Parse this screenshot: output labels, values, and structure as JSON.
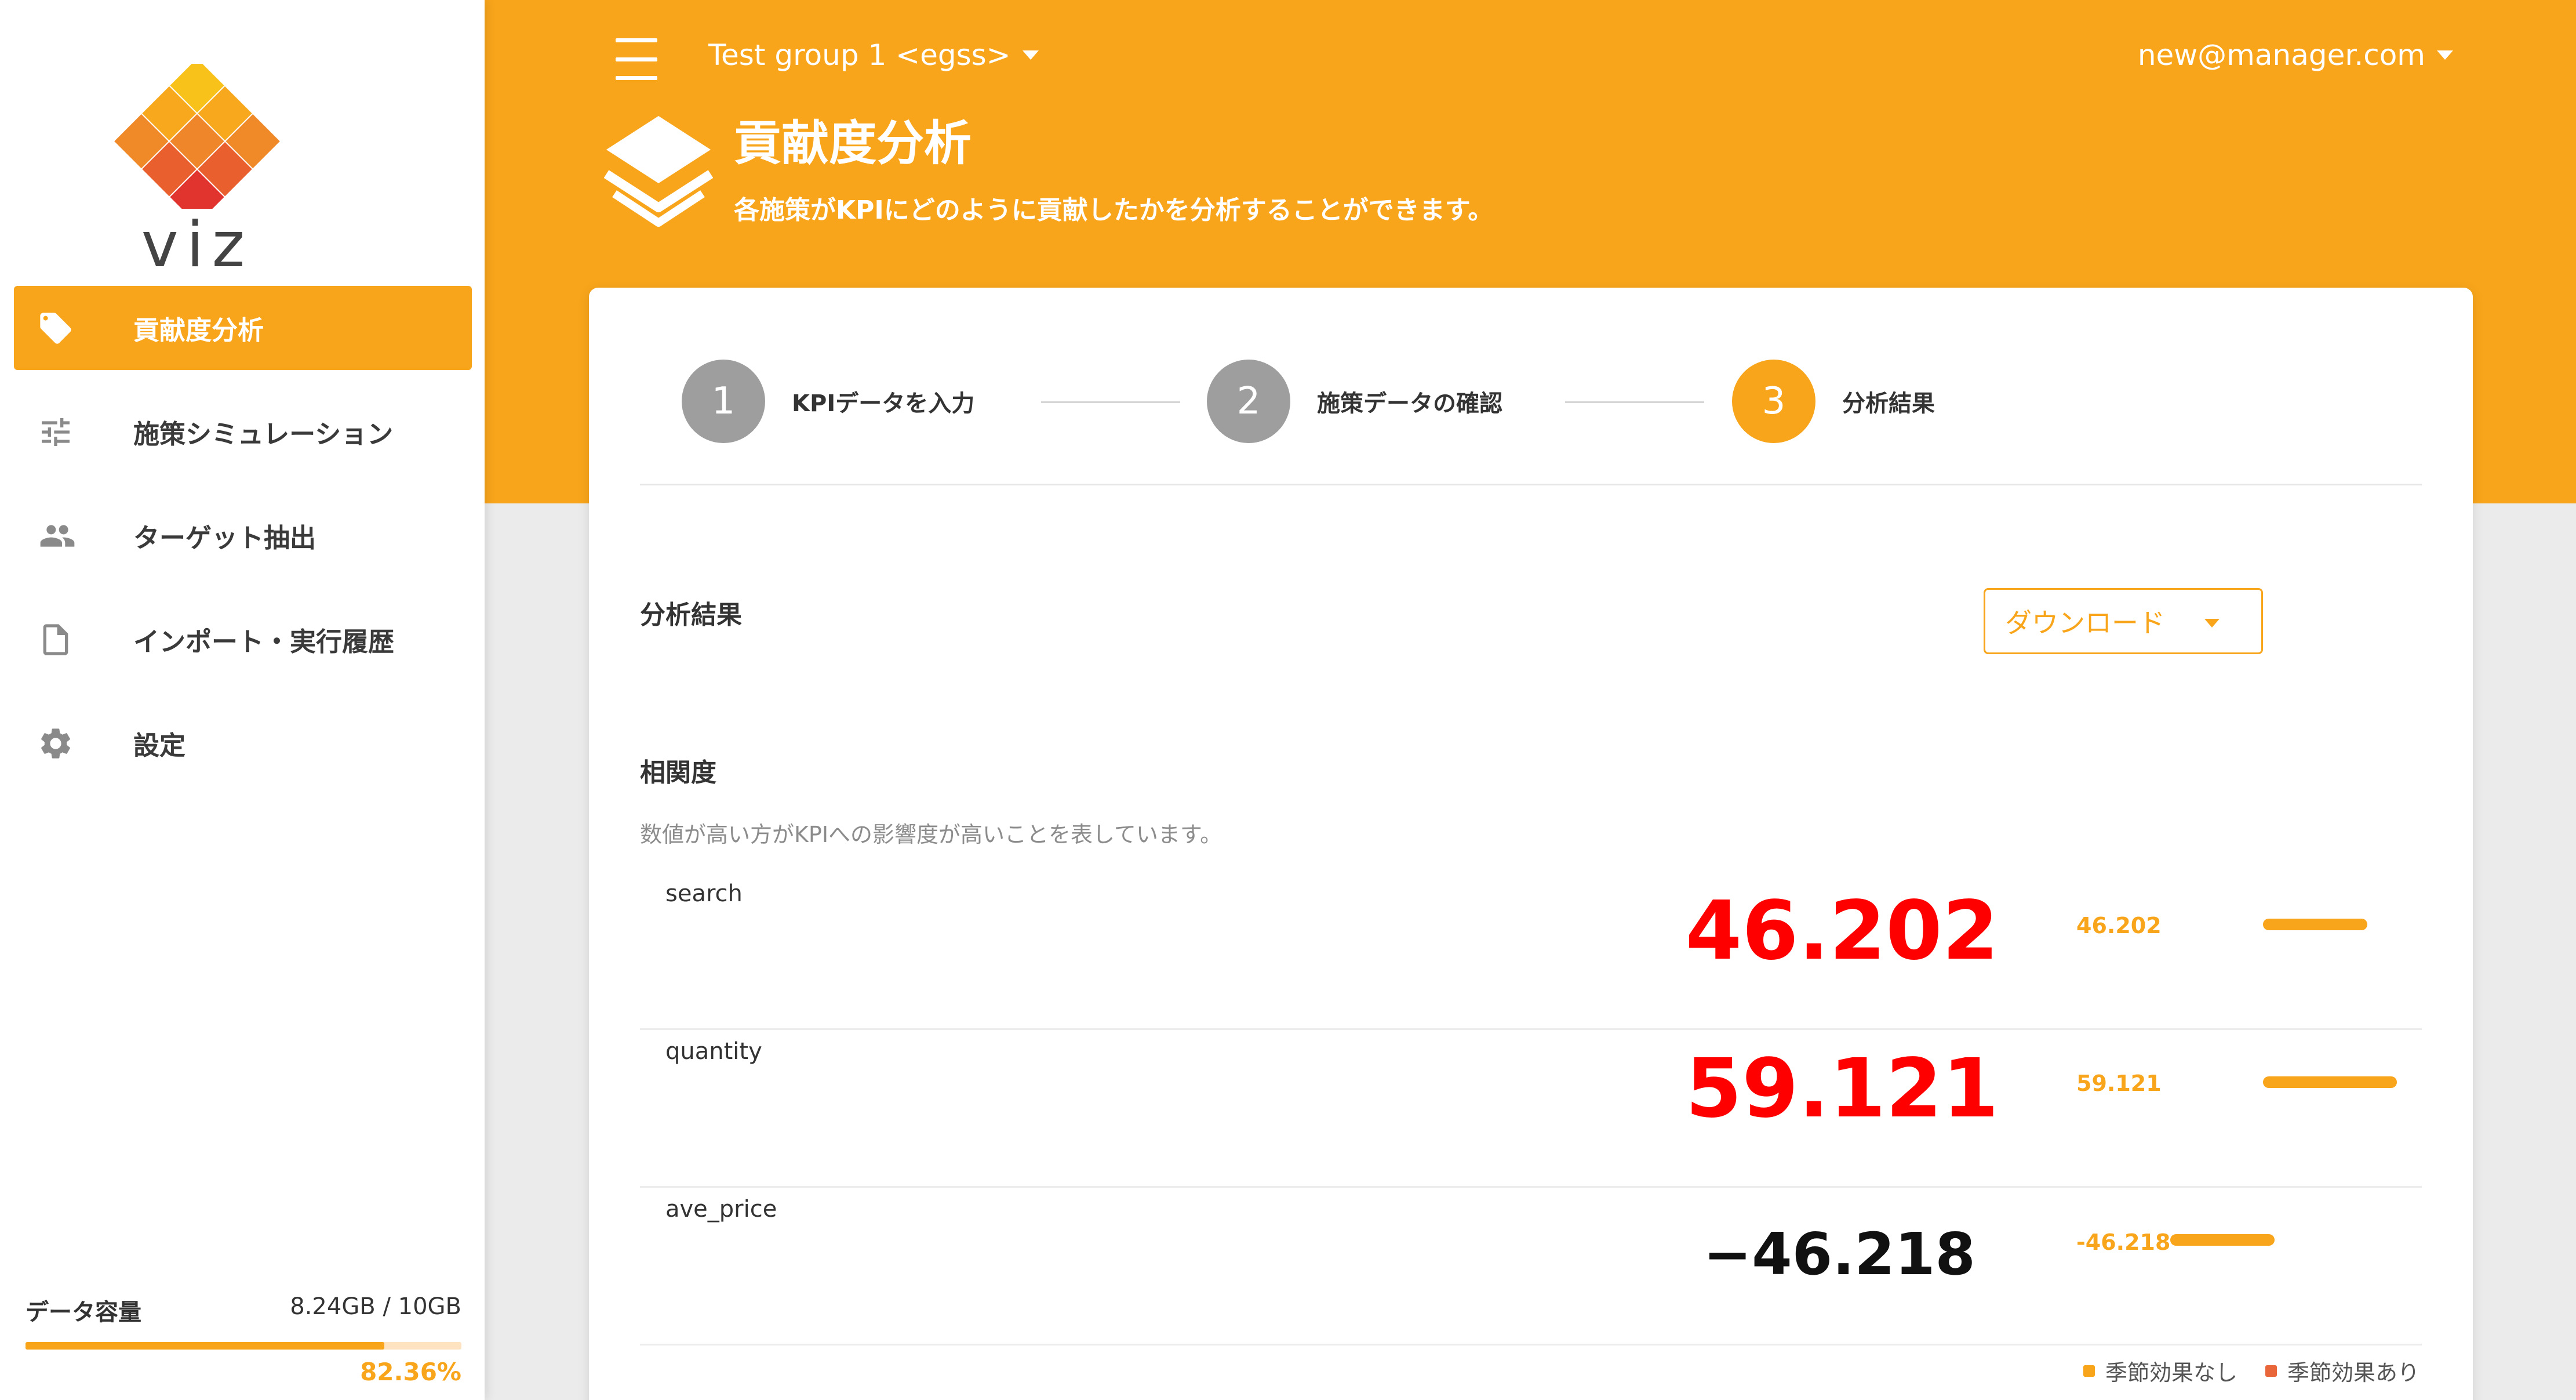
{
  "sidebar": {
    "logo_text": "viz",
    "items": [
      {
        "label": "貢献度分析",
        "icon": "tag-icon",
        "active": true
      },
      {
        "label": "施策シミュレーション",
        "icon": "sliders-icon",
        "active": false
      },
      {
        "label": "ターゲット抽出",
        "icon": "people-icon",
        "active": false
      },
      {
        "label": "インポート・実行履歴",
        "icon": "file-icon",
        "active": false
      },
      {
        "label": "設定",
        "icon": "gear-icon",
        "active": false
      }
    ],
    "storage": {
      "label": "データ容量",
      "usage": "8.24GB / 10GB",
      "percent_text": "82.36%",
      "percent": 82.36
    }
  },
  "header": {
    "group": "Test group 1 <egss>",
    "user": "new@manager.com",
    "title": "貢献度分析",
    "subtitle": "各施策がKPIにどのように貢献したかを分析することができます。"
  },
  "stepper": {
    "steps": [
      {
        "number": "1",
        "label": "KPIデータを入力",
        "state": "done"
      },
      {
        "number": "2",
        "label": "施策データの確認",
        "state": "done"
      },
      {
        "number": "3",
        "label": "分析結果",
        "state": "active"
      }
    ]
  },
  "results": {
    "section_title": "分析結果",
    "download_label": "ダウンロード",
    "correlation_title": "相関度",
    "correlation_desc": "数値が高い方がKPIへの影響度が高いことを表しています。",
    "rows": [
      {
        "name": "search",
        "value_display": "46.202",
        "value_small": "46.202",
        "value": 46.202,
        "value_color": "#ff0000"
      },
      {
        "name": "quantity",
        "value_display": "59.121",
        "value_small": "59.121",
        "value": 59.121,
        "value_color": "#ff0000"
      },
      {
        "name": "ave_price",
        "value_display": "−46.218",
        "value_small": "-46.218",
        "value": -46.218,
        "value_color": "#111111"
      }
    ],
    "legend": [
      {
        "label": "季節効果なし",
        "color": "#f8a51b"
      },
      {
        "label": "季節効果あり",
        "color": "#e8663a"
      }
    ]
  },
  "colors": {
    "accent": "#f8a51b",
    "highlight_value": "#ff0000"
  }
}
